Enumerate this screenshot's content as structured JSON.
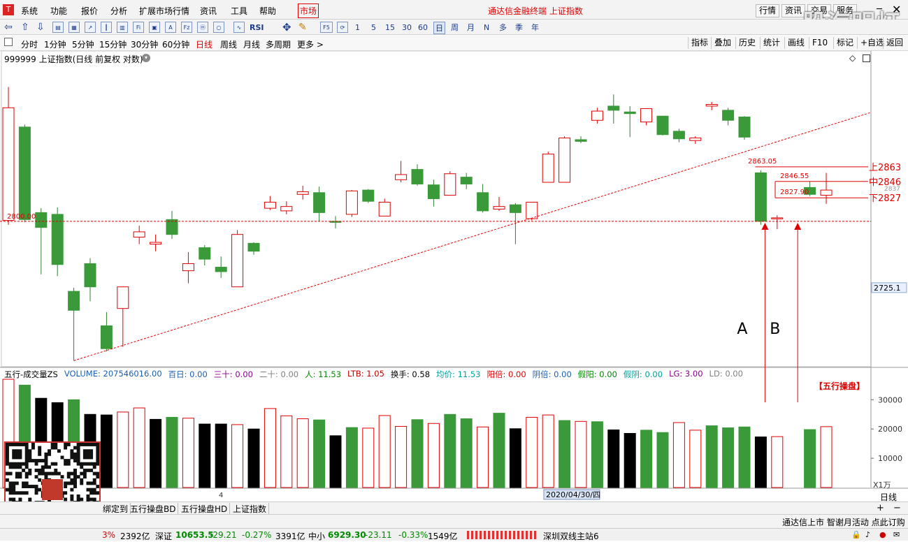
{
  "menu": {
    "items": [
      "系统",
      "功能",
      "报价",
      "分析",
      "扩展市场行情",
      "资讯",
      "工具",
      "帮助"
    ],
    "active": "市场",
    "window_title": "通达信金融终端 上证指数",
    "right_buttons": [
      "行情",
      "资讯",
      "交易",
      "服务"
    ],
    "watermark": "股海明灯"
  },
  "toolbar": {
    "periods": [
      "1",
      "5",
      "15",
      "30",
      "60"
    ],
    "cycle_buttons": [
      "日",
      "周",
      "月",
      "N",
      "多",
      "季",
      "年"
    ],
    "rsi_label": "RSI",
    "f5_label": "F5"
  },
  "periodbar": {
    "items": [
      "分时",
      "1分钟",
      "5分钟",
      "15分钟",
      "30分钟",
      "60分钟",
      "日线",
      "周线",
      "月线",
      "多周期",
      "更多 >"
    ],
    "active": "日线",
    "right_buttons": [
      "指标",
      "叠加",
      "历史",
      "统计",
      "画线",
      "F10",
      "标记",
      "+自选",
      "返回"
    ]
  },
  "chart_title": "999999 上证指数(日线 前复权 对数)",
  "chart_data": {
    "type": "candlestick",
    "ylim": [
      2640,
      2995
    ],
    "y_ticks": [
      {
        "value": 2725.1,
        "label": "2725.1"
      }
    ],
    "candles": [
      {
        "o": 2801,
        "c": 2933,
        "h": 2958,
        "l": 2796,
        "up": true
      },
      {
        "o": 2910,
        "c": 2802,
        "h": 2913,
        "l": 2799,
        "up": false
      },
      {
        "o": 2810,
        "c": 2793,
        "h": 2815,
        "l": 2740,
        "up": false
      },
      {
        "o": 2808,
        "c": 2751,
        "h": 2816,
        "l": 2738,
        "up": false
      },
      {
        "o": 2721,
        "c": 2700,
        "h": 2725,
        "l": 2645,
        "up": false
      },
      {
        "o": 2726,
        "c": 2752,
        "h": 2758,
        "l": 2710,
        "up": false
      },
      {
        "o": 2683,
        "c": 2658,
        "h": 2698,
        "l": 2655,
        "up": false
      },
      {
        "o": 2702,
        "c": 2726,
        "h": 2726,
        "l": 2660,
        "up": true
      },
      {
        "o": 2782,
        "c": 2788,
        "h": 2795,
        "l": 2774,
        "up": true
      },
      {
        "o": 2774,
        "c": 2776,
        "h": 2785,
        "l": 2766,
        "up": true
      },
      {
        "o": 2785,
        "c": 2802,
        "h": 2812,
        "l": 2780,
        "up": false
      },
      {
        "o": 2744,
        "c": 2752,
        "h": 2765,
        "l": 2730,
        "up": true
      },
      {
        "o": 2770,
        "c": 2757,
        "h": 2773,
        "l": 2750,
        "up": false
      },
      {
        "o": 2748,
        "c": 2743,
        "h": 2760,
        "l": 2736,
        "up": false
      },
      {
        "o": 2726,
        "c": 2785,
        "h": 2790,
        "l": 2726,
        "up": true
      },
      {
        "o": 2775,
        "c": 2766,
        "h": 2776,
        "l": 2762,
        "up": false
      },
      {
        "o": 2815,
        "c": 2822,
        "h": 2829,
        "l": 2813,
        "up": true
      },
      {
        "o": 2817,
        "c": 2812,
        "h": 2823,
        "l": 2808,
        "up": true
      },
      {
        "o": 2831,
        "c": 2834,
        "h": 2841,
        "l": 2825,
        "up": true
      },
      {
        "o": 2810,
        "c": 2833,
        "h": 2840,
        "l": 2800,
        "up": false
      },
      {
        "o": 2800,
        "c": 2799,
        "h": 2806,
        "l": 2792,
        "up": false
      },
      {
        "o": 2808,
        "c": 2835,
        "h": 2836,
        "l": 2805,
        "up": true
      },
      {
        "o": 2823,
        "c": 2836,
        "h": 2837,
        "l": 2821,
        "up": false
      },
      {
        "o": 2806,
        "c": 2822,
        "h": 2826,
        "l": 2806,
        "up": true
      },
      {
        "o": 2848,
        "c": 2854,
        "h": 2870,
        "l": 2845,
        "up": true
      },
      {
        "o": 2843,
        "c": 2860,
        "h": 2866,
        "l": 2841,
        "up": false
      },
      {
        "o": 2842,
        "c": 2826,
        "h": 2848,
        "l": 2817,
        "up": false
      },
      {
        "o": 2830,
        "c": 2855,
        "h": 2858,
        "l": 2830,
        "up": true
      },
      {
        "o": 2851,
        "c": 2843,
        "h": 2856,
        "l": 2837,
        "up": false
      },
      {
        "o": 2833,
        "c": 2812,
        "h": 2843,
        "l": 2810,
        "up": false
      },
      {
        "o": 2814,
        "c": 2817,
        "h": 2828,
        "l": 2812,
        "up": true
      },
      {
        "o": 2819,
        "c": 2810,
        "h": 2821,
        "l": 2774,
        "up": false
      },
      {
        "o": 2803,
        "c": 2822,
        "h": 2822,
        "l": 2801,
        "up": true
      },
      {
        "o": 2845,
        "c": 2878,
        "h": 2881,
        "l": 2845,
        "up": true
      },
      {
        "o": 2845,
        "c": 2897,
        "h": 2899,
        "l": 2845,
        "up": true
      },
      {
        "o": 2895,
        "c": 2893,
        "h": 2899,
        "l": 2891,
        "up": false
      },
      {
        "o": 2918,
        "c": 2929,
        "h": 2933,
        "l": 2914,
        "up": true
      },
      {
        "o": 2930,
        "c": 2935,
        "h": 2949,
        "l": 2914,
        "up": false
      },
      {
        "o": 2928,
        "c": 2926,
        "h": 2935,
        "l": 2898,
        "up": false
      },
      {
        "o": 2916,
        "c": 2932,
        "h": 2932,
        "l": 2912,
        "up": true
      },
      {
        "o": 2923,
        "c": 2901,
        "h": 2923,
        "l": 2900,
        "up": false
      },
      {
        "o": 2905,
        "c": 2896,
        "h": 2908,
        "l": 2892,
        "up": false
      },
      {
        "o": 2897,
        "c": 2894,
        "h": 2899,
        "l": 2890,
        "up": true
      },
      {
        "o": 2937,
        "c": 2935,
        "h": 2940,
        "l": 2930,
        "up": true
      },
      {
        "o": 2930,
        "c": 2918,
        "h": 2933,
        "l": 2912,
        "up": false
      },
      {
        "o": 2922,
        "c": 2898,
        "h": 2923,
        "l": 2895,
        "up": false
      },
      {
        "o": 2856,
        "c": 2800,
        "h": 2859,
        "l": 2796,
        "up": false
      },
      {
        "o": 2804,
        "c": 2804,
        "h": 2807,
        "l": 2791,
        "up": true
      },
      null,
      {
        "o": 2839,
        "c": 2831,
        "h": 2846,
        "l": 2829,
        "up": false
      },
      {
        "o": 2830,
        "c": 2836,
        "h": 2856,
        "l": 2820,
        "up": true
      }
    ],
    "volumes": [
      {
        "v": 37000,
        "c": "red"
      },
      {
        "v": 35000,
        "c": "green"
      },
      {
        "v": 30500,
        "c": "black"
      },
      {
        "v": 29000,
        "c": "black"
      },
      {
        "v": 30000,
        "c": "green"
      },
      {
        "v": 25000,
        "c": "black"
      },
      {
        "v": 24800,
        "c": "black"
      },
      {
        "v": 25800,
        "c": "red"
      },
      {
        "v": 27200,
        "c": "red"
      },
      {
        "v": 23300,
        "c": "black"
      },
      {
        "v": 24000,
        "c": "green"
      },
      {
        "v": 23700,
        "c": "red"
      },
      {
        "v": 21700,
        "c": "black"
      },
      {
        "v": 21700,
        "c": "black"
      },
      {
        "v": 21500,
        "c": "red"
      },
      {
        "v": 20000,
        "c": "black"
      },
      {
        "v": 27000,
        "c": "red"
      },
      {
        "v": 24500,
        "c": "red"
      },
      {
        "v": 23500,
        "c": "red"
      },
      {
        "v": 23100,
        "c": "green"
      },
      {
        "v": 17700,
        "c": "black"
      },
      {
        "v": 20500,
        "c": "green"
      },
      {
        "v": 20300,
        "c": "red"
      },
      {
        "v": 24600,
        "c": "red"
      },
      {
        "v": 20900,
        "c": "red"
      },
      {
        "v": 23200,
        "c": "green"
      },
      {
        "v": 21900,
        "c": "red"
      },
      {
        "v": 25000,
        "c": "green"
      },
      {
        "v": 23500,
        "c": "green"
      },
      {
        "v": 20700,
        "c": "red"
      },
      {
        "v": 25400,
        "c": "green"
      },
      {
        "v": 20100,
        "c": "black"
      },
      {
        "v": 24000,
        "c": "red"
      },
      {
        "v": 24800,
        "c": "red"
      },
      {
        "v": 22900,
        "c": "green"
      },
      {
        "v": 22600,
        "c": "red"
      },
      {
        "v": 22500,
        "c": "green"
      },
      {
        "v": 19700,
        "c": "black"
      },
      {
        "v": 18500,
        "c": "black"
      },
      {
        "v": 19600,
        "c": "green"
      },
      {
        "v": 18800,
        "c": "green"
      },
      {
        "v": 22200,
        "c": "red"
      },
      {
        "v": 19600,
        "c": "red"
      },
      {
        "v": 21100,
        "c": "green"
      },
      {
        "v": 20400,
        "c": "green"
      },
      {
        "v": 20700,
        "c": "green"
      },
      {
        "v": 17300,
        "c": "black"
      },
      {
        "v": 17400,
        "c": "red"
      },
      null,
      {
        "v": 19800,
        "c": "green"
      },
      {
        "v": 20800,
        "c": "red"
      }
    ],
    "volume_ylim": [
      0,
      37000
    ],
    "volume_ticks": [
      10000,
      20000,
      30000
    ],
    "volume_unit": "X1万",
    "support_level": 2800,
    "support_label": "2800.00",
    "trendline_label_high": "2863.05",
    "box_labels": [
      "2846.55",
      "2827.90"
    ],
    "box_levels": {
      "upper": 2863,
      "middle": 2846,
      "lower": 2827
    },
    "right_labels": [
      "上2863",
      "中2846",
      "下2827"
    ],
    "small_right_label": "2837",
    "annotations": [
      "A",
      "B"
    ],
    "volume_annotation": "【五行操盘】",
    "date_label": "2020/04/30/四",
    "axis_digit": "4"
  },
  "indicator": {
    "items": [
      {
        "label": "五行-成交量ZS",
        "color": "#000000"
      },
      {
        "label": "VOLUME: 207546016.00",
        "color": "#1a5fb4"
      },
      {
        "label": "百日: 0.00",
        "color": "#1a5fb4"
      },
      {
        "label": "三十: 0.00",
        "color": "#8b008b"
      },
      {
        "label": "二十: 0.00",
        "color": "#808080"
      },
      {
        "label": "人: 11.53",
        "color": "#008a00"
      },
      {
        "label": "LTB: 1.05",
        "color": "#c00000"
      },
      {
        "label": "换手: 0.58",
        "color": "#000000"
      },
      {
        "label": "均价: 11.53",
        "color": "#00a0a0"
      },
      {
        "label": "阳倍: 0.00",
        "color": "#e00000"
      },
      {
        "label": "阴倍: 0.00",
        "color": "#1a5fb4"
      },
      {
        "label": "假阳: 0.00",
        "color": "#008a00"
      },
      {
        "label": "假阴: 0.00",
        "color": "#00a0a0"
      },
      {
        "label": "LG: 3.00",
        "color": "#8b008b"
      },
      {
        "label": "LD: 0.00",
        "color": "#808080"
      }
    ]
  },
  "tabs": [
    "绑定到",
    "五行操盘BD",
    "五行操盘HD",
    "上证指数"
  ],
  "status": {
    "text": "通达信上市 智谢月活动 点此订购",
    "cycle": "日线"
  },
  "ticker": {
    "partial_pct": "3%",
    "partial_amount": "2392亿",
    "items": [
      {
        "name": "深证",
        "price": "10653.5",
        "chg": "-29.21",
        "pct": "-0.27%",
        "amount": "3391亿"
      },
      {
        "name": "中小",
        "price": "6929.30",
        "chg": "-23.11",
        "pct": "-0.33%",
        "amount": "1549亿"
      }
    ],
    "server": "深圳双线主站6"
  },
  "colors": {
    "up": "#e00000",
    "down": "#3a9a3a",
    "dashed": "#e00000",
    "menu_active": "#e00000"
  }
}
